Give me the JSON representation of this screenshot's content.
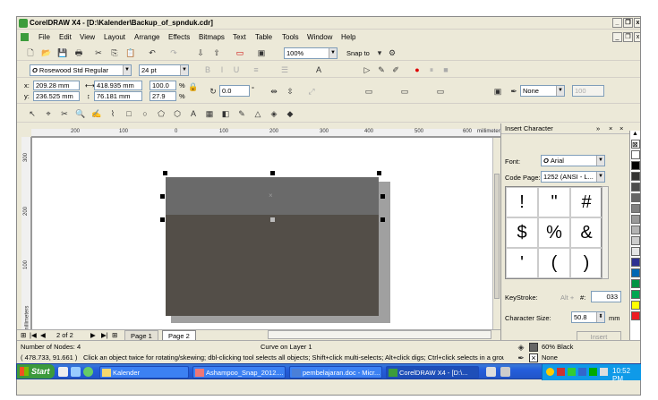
{
  "window": {
    "title": "CorelDRAW X4 - [D:\\Kalender\\Backup_of_spnduk.cdr]",
    "minimize": "_",
    "restore": "❐",
    "close": "x"
  },
  "menu": [
    "File",
    "Edit",
    "View",
    "Layout",
    "Arrange",
    "Effects",
    "Bitmaps",
    "Text",
    "Table",
    "Tools",
    "Window",
    "Help"
  ],
  "standard_toolbar": {
    "zoom": "100%",
    "snap_to": "Snap to"
  },
  "text_toolbar": {
    "font": "Rosewood Std Regular",
    "size": "24 pt"
  },
  "property_bar": {
    "x": "209.28 mm",
    "y": "236.525 mm",
    "width": "418.935 mm",
    "height": "76.181 mm",
    "scale_x": "100.0",
    "scale_y": "27.9",
    "percent": "%",
    "angle": "0.0",
    "degree": "°",
    "outline": "None",
    "outline_width": "100"
  },
  "ruler": {
    "unit": "millimeters",
    "top_ticks": [
      "200",
      "100",
      "0",
      "100",
      "200",
      "300",
      "400",
      "500",
      "600"
    ],
    "left_ticks": [
      "300",
      "200",
      "100"
    ],
    "left_unit": "millimeters"
  },
  "docker": {
    "title": "Insert Character",
    "font_label": "Font:",
    "font_value": "Arial",
    "code_page_label": "Code Page:",
    "code_page_value": "1252 (ANSI - L...",
    "chars": [
      "!",
      "\"",
      "#",
      "$",
      "%",
      "&",
      "'",
      "(",
      ")"
    ],
    "keystroke_label": "KeyStroke:",
    "keystroke_alt": "Alt +",
    "keystroke_hash": "#:",
    "keystroke_value": "033",
    "char_size_label": "Character Size:",
    "char_size_value": "50.8",
    "char_size_unit": "mm",
    "insert_button": "Insert"
  },
  "page_nav": {
    "counter": "2 of 2",
    "tabs": [
      "Page 1",
      "Page 2"
    ]
  },
  "status": {
    "nodes": "Number of Nodes: 4",
    "layer": "Curve on Layer 1",
    "coords": "( 478.733, 91.661 )",
    "hint": "Click an object twice for rotating/skewing; dbl-clicking tool selects all objects; Shift+click multi-selects; Alt+click digs; Ctrl+click selects in a group",
    "fill": "60% Black",
    "outline": "None"
  },
  "taskbar": {
    "start": "Start",
    "tasks": [
      "Kalender",
      "Ashampoo_Snap_2012....",
      "pembelajaran.doc - Micr...",
      "CorelDRAW X4 - [D:\\..."
    ],
    "clock": "10:52 PM"
  },
  "colors": {
    "fill": "#534e48",
    "fill_top": "#6a6a6a",
    "palette": [
      "#ffffff",
      "#000000",
      "#333333",
      "#4d4d4d",
      "#666666",
      "#808080",
      "#999999",
      "#b3b3b3",
      "#cccccc",
      "#e5e5e5",
      "#2e3192",
      "#0066b3",
      "#009444",
      "#00a651",
      "#ffff00",
      "#ed1c24"
    ]
  }
}
